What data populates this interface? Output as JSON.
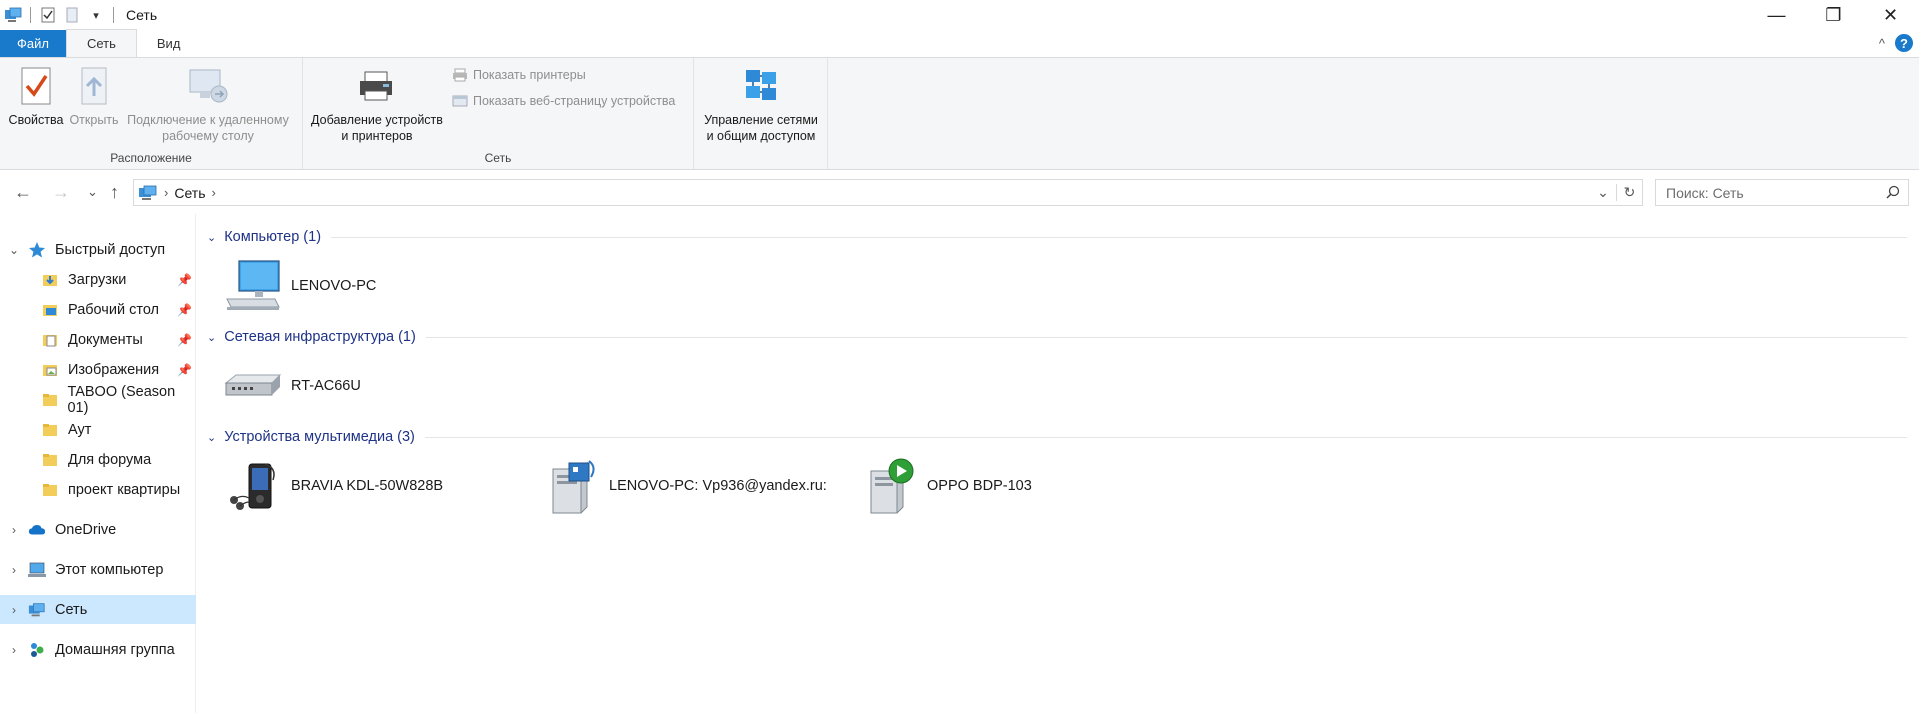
{
  "window": {
    "title": "Сеть",
    "controls": {
      "minimize": "—",
      "maximize": "❐",
      "close": "✕"
    }
  },
  "tabs": {
    "file": "Файл",
    "network": "Сеть",
    "view": "Вид",
    "collapse": "^",
    "help": "?"
  },
  "ribbon": {
    "location_group": {
      "label": "Расположение",
      "properties": "Свойства",
      "open": "Открыть",
      "remote_l1": "Подключение к удаленному",
      "remote_l2": "рабочему столу"
    },
    "network_group": {
      "label": "Сеть",
      "add_devices_l1": "Добавление устройств",
      "add_devices_l2": "и принтеров",
      "show_printers": "Показать принтеры",
      "show_webpage": "Показать веб-страницу устройства"
    },
    "sharing_group": {
      "center_l1": "Управление сетями",
      "center_l2": "и общим доступом"
    }
  },
  "address": {
    "back": "←",
    "forward": "→",
    "recent": "⌄",
    "up": "↑",
    "crumb": "Сеть",
    "chevron": "›",
    "dropdown": "⌄",
    "refresh": "↻"
  },
  "search": {
    "placeholder": "Поиск: Сеть"
  },
  "sidebar": {
    "quick_access": "Быстрый доступ",
    "items": [
      {
        "label": "Загрузки",
        "pinned": true,
        "icon": "downloads-folder-icon"
      },
      {
        "label": "Рабочий стол",
        "pinned": true,
        "icon": "desktop-folder-icon"
      },
      {
        "label": "Документы",
        "pinned": true,
        "icon": "documents-folder-icon"
      },
      {
        "label": "Изображения",
        "pinned": true,
        "icon": "pictures-folder-icon"
      },
      {
        "label": "TABOO (Season 01)",
        "pinned": false,
        "icon": "folder-icon"
      },
      {
        "label": "Аут",
        "pinned": false,
        "icon": "folder-icon"
      },
      {
        "label": "Для форума",
        "pinned": false,
        "icon": "folder-icon"
      },
      {
        "label": "проект квартиры",
        "pinned": false,
        "icon": "folder-icon"
      }
    ],
    "onedrive": "OneDrive",
    "this_pc": "Этот компьютер",
    "network": "Сеть",
    "homegroup": "Домашняя группа"
  },
  "content": {
    "groups": [
      {
        "title": "Компьютер (1)",
        "items": [
          {
            "label": "LENOVO-PC",
            "icon": "computer-icon"
          }
        ]
      },
      {
        "title": "Сетевая инфраструктура (1)",
        "items": [
          {
            "label": "RT-AC66U",
            "icon": "router-icon"
          }
        ]
      },
      {
        "title": "Устройства мультимедиа (3)",
        "items": [
          {
            "label": "BRAVIA KDL-50W828B",
            "icon": "media-player-icon"
          },
          {
            "label": "LENOVO-PC: Vp936@yandex.ru:",
            "icon": "media-server-icon"
          },
          {
            "label": "OPPO BDP-103",
            "icon": "media-renderer-icon"
          }
        ]
      }
    ]
  },
  "colors": {
    "accent": "#1979ca",
    "group_header": "#1e3287",
    "selection": "#cce8ff",
    "ribbon_bg": "#f5f6f7"
  }
}
